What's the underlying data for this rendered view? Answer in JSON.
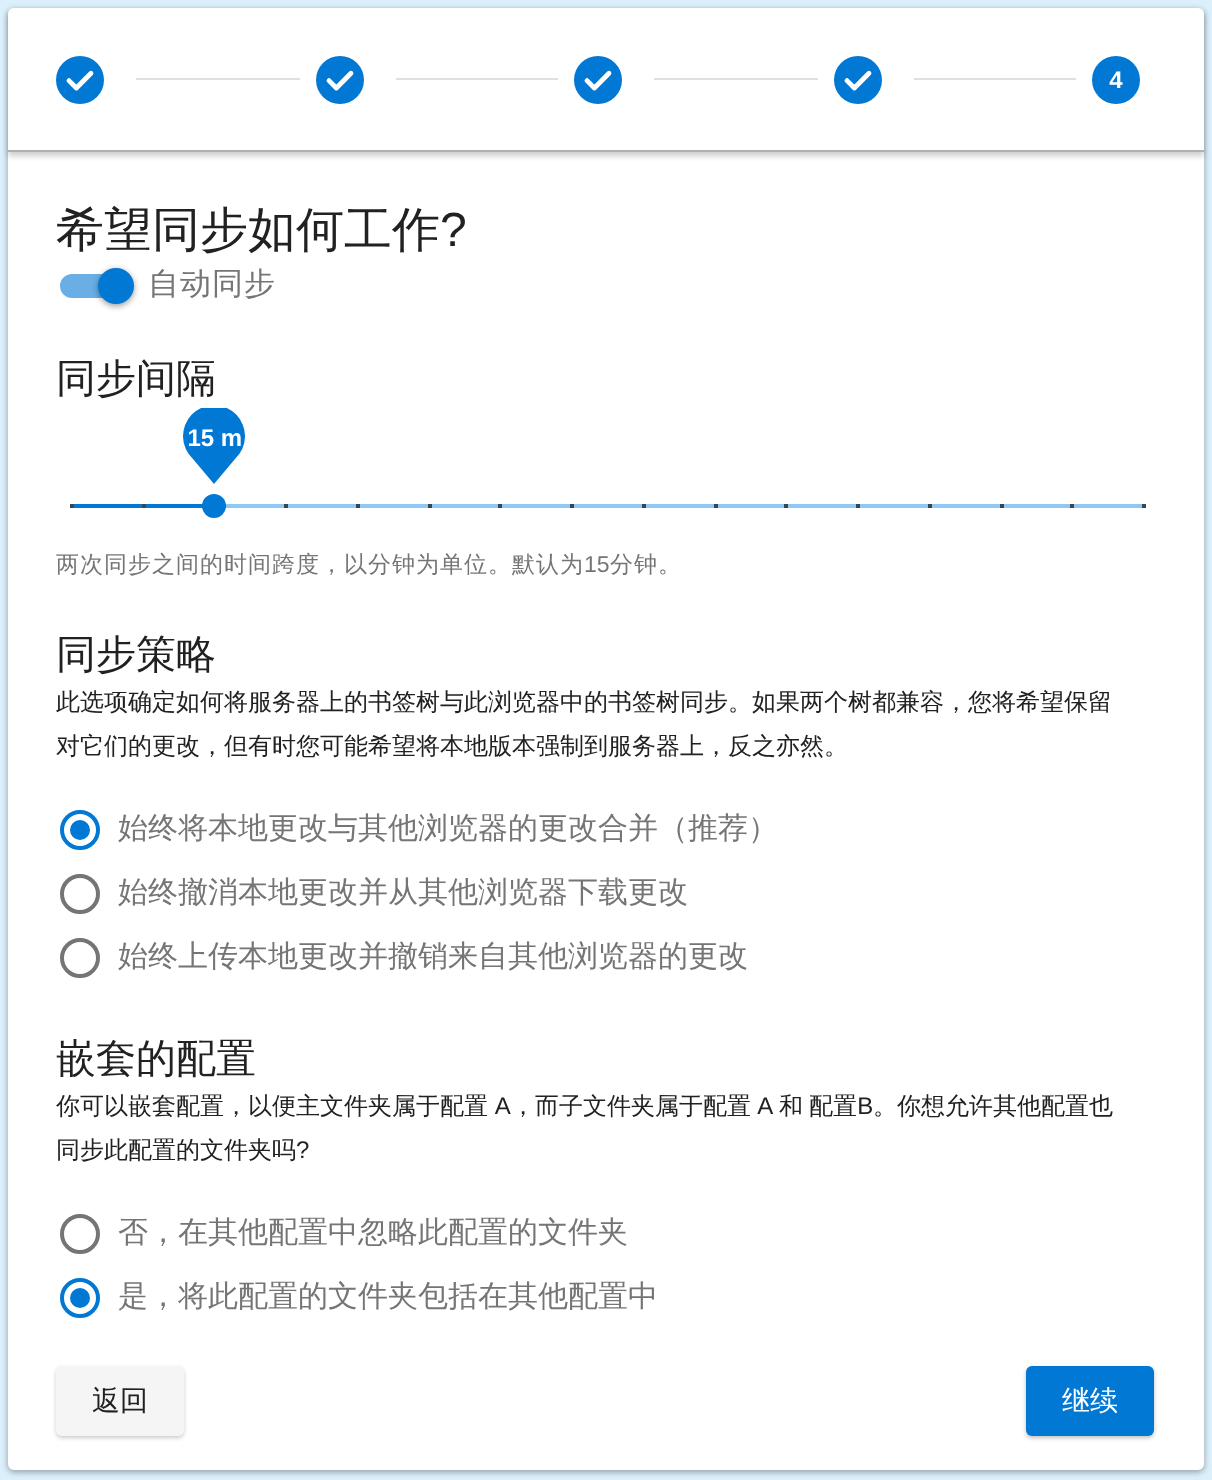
{
  "stepper": {
    "steps": [
      {
        "completed": true
      },
      {
        "completed": true
      },
      {
        "completed": true
      },
      {
        "completed": true
      },
      {
        "completed": false,
        "label": "4"
      }
    ]
  },
  "title": "希望同步如何工作?",
  "auto_sync": {
    "label": "自动同步",
    "on": true
  },
  "interval": {
    "heading": "同步间隔",
    "slider": {
      "level": 0.1333,
      "value_label": "15 m"
    },
    "help": "两次同步之间的时间跨度，以分钟为单位。默认为15分钟。"
  },
  "strategy": {
    "heading": "同步策略",
    "description": "此选项确定如何将服务器上的书签树与此浏览器中的书签树同步。如果两个树都兼容，您将希望保留对它们的更改，但有时您可能希望将本地版本强制到服务器上，反之亦然。",
    "options": [
      {
        "label": "始终将本地更改与其他浏览器的更改合并（推荐）",
        "selected": true
      },
      {
        "label": "始终撤消本地更改并从其他浏览器下载更改",
        "selected": false
      },
      {
        "label": "始终上传本地更改并撤销来自其他浏览器的更改",
        "selected": false
      }
    ]
  },
  "nesting": {
    "heading": "嵌套的配置",
    "description": "你可以嵌套配置，以便主文件夹属于配置 A，而子文件夹属于配置 A 和 配置B。你想允许其他配置也同步此配置的文件夹吗?",
    "options": [
      {
        "label": "否，在其他配置中忽略此配置的文件夹",
        "selected": false
      },
      {
        "label": "是，将此配置的文件夹包括在其他配置中",
        "selected": true
      }
    ]
  },
  "buttons": [
    {
      "label": "返回",
      "kind": "secondary"
    },
    {
      "label": "继续",
      "kind": "primary"
    }
  ]
}
